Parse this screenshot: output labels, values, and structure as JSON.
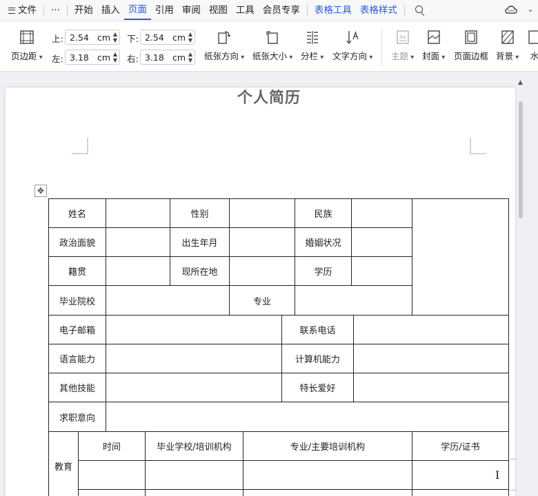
{
  "menu": {
    "file": "文件",
    "more": "···",
    "tabs": [
      "开始",
      "插入",
      "页面",
      "引用",
      "审阅",
      "视图",
      "工具",
      "会员专享"
    ],
    "active_tab": "页面",
    "context_tabs": [
      "表格工具",
      "表格样式"
    ],
    "accent_color": "#2b5ad8"
  },
  "ribbon": {
    "margins_btn": "页边距",
    "top_label": "上:",
    "top_value": "2.54",
    "bottom_label": "下:",
    "bottom_value": "2.54",
    "left_label": "左:",
    "left_value": "3.18",
    "right_label": "右:",
    "right_value": "3.18",
    "unit": "cm",
    "orientation": "纸张方向",
    "size": "纸张大小",
    "columns": "分栏",
    "text_direction": "文字方向",
    "theme": "主题",
    "cover": "封面",
    "page_border": "页面边框",
    "background": "背景",
    "watermark": "水"
  },
  "document": {
    "title": "个人简历",
    "labels": {
      "name": "姓名",
      "gender": "性别",
      "ethnicity": "民族",
      "politics": "政治面貌",
      "birth": "出生年月",
      "marital": "婚姻状况",
      "origin": "籍贯",
      "residence": "现所在地",
      "education_level": "学历",
      "school": "毕业院校",
      "major": "专业",
      "email": "电子邮箱",
      "phone": "联系电话",
      "language": "语言能力",
      "computer": "计算机能力",
      "other_skills": "其他技能",
      "hobbies": "特长爱好",
      "objective": "求职意向",
      "education": "教育",
      "col_time": "时间",
      "col_school": "毕业学校/培训机构",
      "col_major": "专业/主要培训机构",
      "col_cert": "学历/证书"
    }
  }
}
